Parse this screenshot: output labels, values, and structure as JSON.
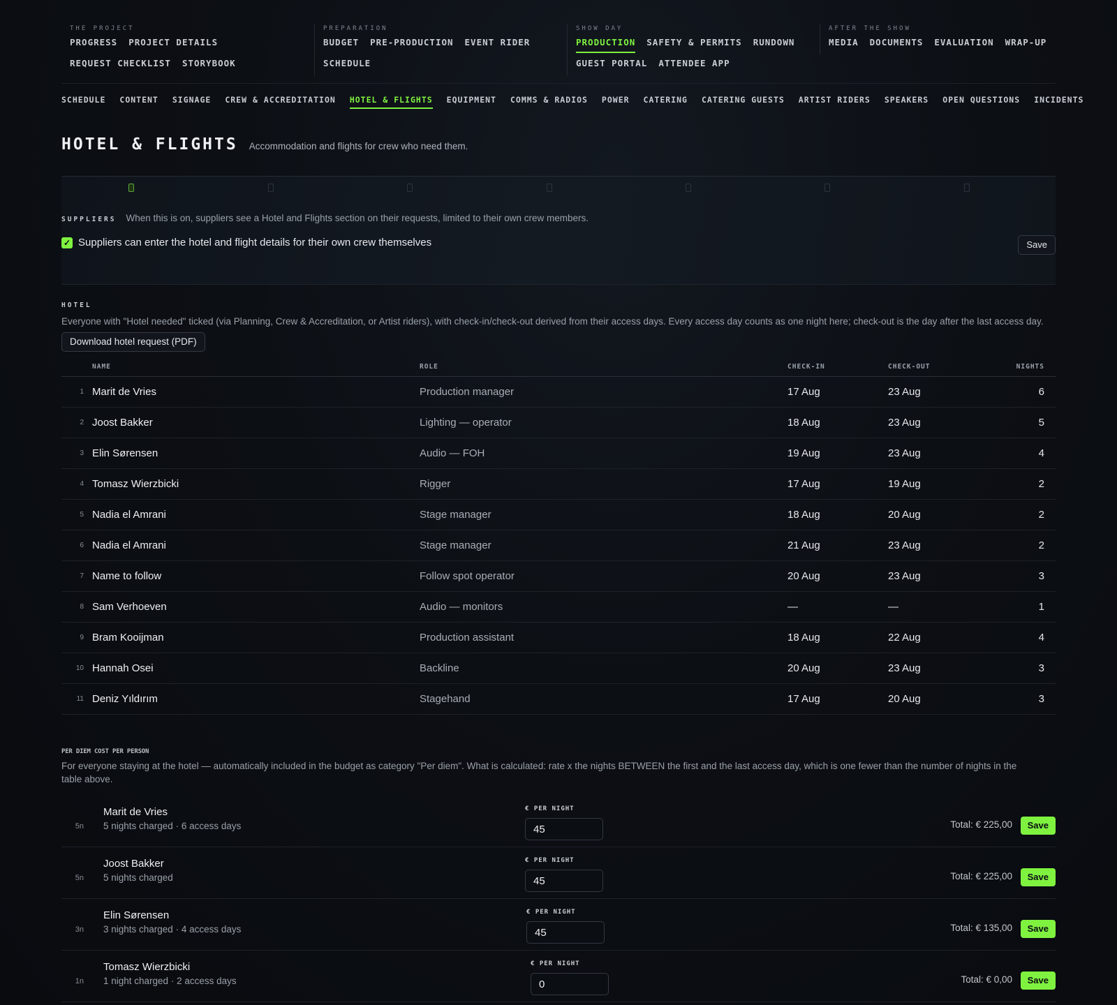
{
  "top_nav": {
    "groups": [
      {
        "label": "THE PROJECT",
        "items": [
          "PROGRESS",
          "PROJECT DETAILS",
          "REQUEST CHECKLIST",
          "STORYBOOK"
        ]
      },
      {
        "label": "PREPARATION",
        "items": [
          "BUDGET",
          "PRE-PRODUCTION",
          "EVENT RIDER",
          "SCHEDULE"
        ]
      },
      {
        "label": "SHOW DAY",
        "items": [
          "PRODUCTION",
          "SAFETY & PERMITS",
          "RUNDOWN",
          "GUEST PORTAL",
          "ATTENDEE APP"
        ]
      },
      {
        "label": "AFTER THE SHOW",
        "items": [
          "MEDIA",
          "DOCUMENTS",
          "EVALUATION",
          "WRAP-UP"
        ]
      }
    ],
    "active": "PRODUCTION"
  },
  "sub_nav": {
    "items": [
      "SCHEDULE",
      "CONTENT",
      "SIGNAGE",
      "CREW & ACCREDITATION",
      "HOTEL & FLIGHTS",
      "EQUIPMENT",
      "COMMS & RADIOS",
      "POWER",
      "CATERING",
      "CATERING GUESTS",
      "ARTIST RIDERS",
      "SPEAKERS",
      "OPEN QUESTIONS",
      "INCIDENTS"
    ],
    "active": "HOTEL & FLIGHTS"
  },
  "page": {
    "title": "HOTEL & FLIGHTS",
    "subtitle": "Accommodation and flights for crew who need them."
  },
  "suppliers": {
    "label": "SUPPLIERS",
    "description": "When this is on, suppliers see a Hotel and Flights section on their requests, limited to their own crew members.",
    "checkbox_label": "Suppliers can enter the hotel and flight details for their own crew themselves",
    "checked": true,
    "save_label": "Save"
  },
  "hotel": {
    "label": "HOTEL",
    "description": "Everyone with \"Hotel needed\" ticked (via Planning, Crew & Accreditation, or Artist riders), with check-in/check-out derived from their access days. Every access day counts as one night here; check-out is the day after the last access day.",
    "download_label": "Download hotel request (PDF)",
    "columns": {
      "name": "NAME",
      "role": "ROLE",
      "check_in": "CHECK-IN",
      "check_out": "CHECK-OUT",
      "nights": "NIGHTS"
    },
    "rows": [
      {
        "num": "1",
        "name": "Marit de Vries",
        "role": "Production manager",
        "check_in": "17 Aug",
        "check_out": "23 Aug",
        "nights": "6"
      },
      {
        "num": "2",
        "name": "Joost Bakker",
        "role": "Lighting — operator",
        "check_in": "18 Aug",
        "check_out": "23 Aug",
        "nights": "5"
      },
      {
        "num": "3",
        "name": "Elin Sørensen",
        "role": "Audio — FOH",
        "check_in": "19 Aug",
        "check_out": "23 Aug",
        "nights": "4"
      },
      {
        "num": "4",
        "name": "Tomasz Wierzbicki",
        "role": "Rigger",
        "check_in": "17 Aug",
        "check_out": "19 Aug",
        "nights": "2"
      },
      {
        "num": "5",
        "name": "Nadia el Amrani",
        "role": "Stage manager",
        "check_in": "18 Aug",
        "check_out": "20 Aug",
        "nights": "2"
      },
      {
        "num": "6",
        "name": "Nadia el Amrani",
        "role": "Stage manager",
        "check_in": "21 Aug",
        "check_out": "23 Aug",
        "nights": "2"
      },
      {
        "num": "7",
        "name": "Name to follow",
        "role": "Follow spot operator",
        "check_in": "20 Aug",
        "check_out": "23 Aug",
        "nights": "3"
      },
      {
        "num": "8",
        "name": "Sam Verhoeven",
        "role": "Audio — monitors",
        "check_in": "—",
        "check_out": "—",
        "nights": "1"
      },
      {
        "num": "9",
        "name": "Bram Kooijman",
        "role": "Production assistant",
        "check_in": "18 Aug",
        "check_out": "22 Aug",
        "nights": "4"
      },
      {
        "num": "10",
        "name": "Hannah Osei",
        "role": "Backline",
        "check_in": "20 Aug",
        "check_out": "23 Aug",
        "nights": "3"
      },
      {
        "num": "11",
        "name": "Deniz Yıldırım",
        "role": "Stagehand",
        "check_in": "17 Aug",
        "check_out": "20 Aug",
        "nights": "3"
      }
    ]
  },
  "per_diem": {
    "label": "PER DIEM COST PER PERSON",
    "description": "For everyone staying at the hotel — automatically included in the budget as category \"Per diem\". What is calculated: rate x the nights BETWEEN the first and the last access day, which is one fewer than the number of nights in the table above.",
    "field_label": "€ PER NIGHT",
    "save_label": "Save",
    "rows": [
      {
        "badge": "5n",
        "name": "Marit de Vries",
        "meta": "5 nights charged · 6 access days",
        "rate": "45",
        "total": "Total: € 225,00"
      },
      {
        "badge": "5n",
        "name": "Joost Bakker",
        "meta": "5 nights charged",
        "rate": "45",
        "total": "Total: € 225,00"
      },
      {
        "badge": "3n",
        "name": "Elin Sørensen",
        "meta": "3 nights charged · 4 access days",
        "rate": "45",
        "total": "Total: € 135,00"
      },
      {
        "badge": "1n",
        "name": "Tomasz Wierzbicki",
        "meta": "1 night charged · 2 access days",
        "rate": "0",
        "total": "Total: € 0,00"
      }
    ]
  },
  "colors": {
    "accent": "#7ff240",
    "background": "#0c0f14"
  }
}
